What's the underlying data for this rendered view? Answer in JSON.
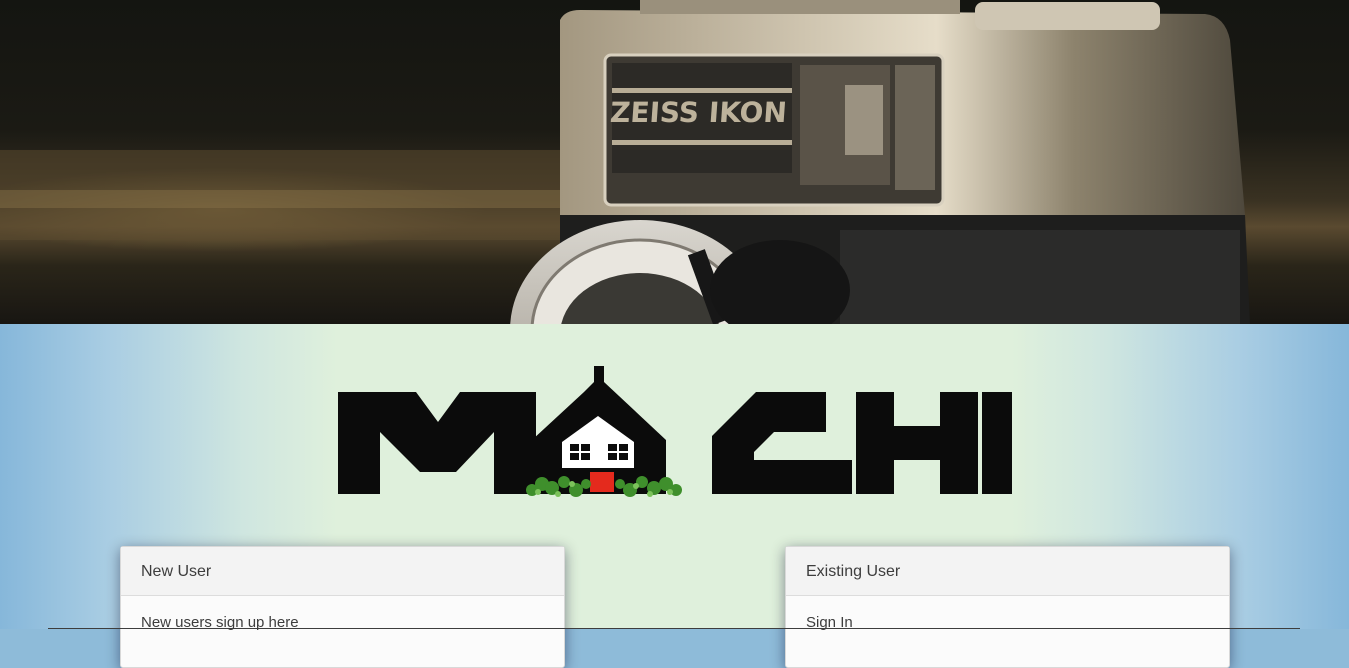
{
  "logo": {
    "text": "MOCHI"
  },
  "cards": {
    "new_user": {
      "header": "New User",
      "body": "New users sign up here"
    },
    "existing_user": {
      "header": "Existing User",
      "body": "Sign In"
    }
  },
  "colors": {
    "accent_red": "#e42a1d",
    "logo_black": "#0b0b0b",
    "gradient_center": "#dff0dc",
    "gradient_edge": "#86b7da"
  }
}
